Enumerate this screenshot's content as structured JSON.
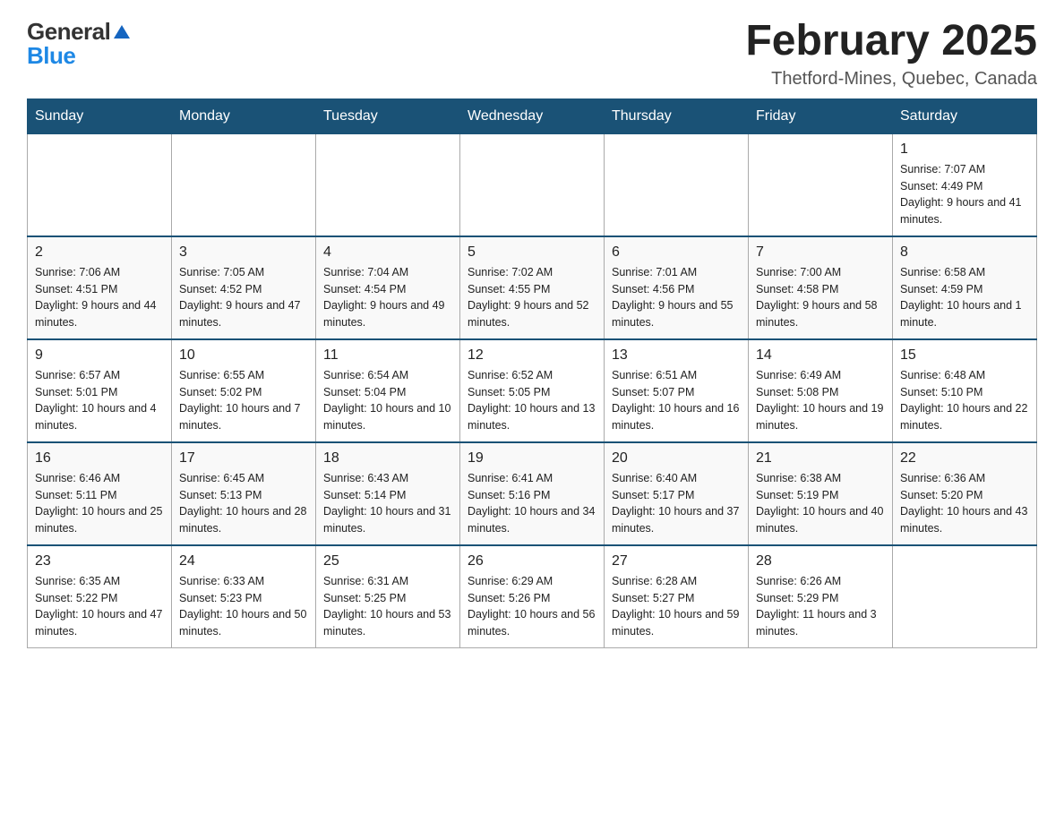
{
  "header": {
    "logo_general": "General",
    "logo_blue": "Blue",
    "month_title": "February 2025",
    "location": "Thetford-Mines, Quebec, Canada"
  },
  "weekdays": [
    "Sunday",
    "Monday",
    "Tuesday",
    "Wednesday",
    "Thursday",
    "Friday",
    "Saturday"
  ],
  "rows": [
    {
      "cells": [
        {
          "day": "",
          "info": ""
        },
        {
          "day": "",
          "info": ""
        },
        {
          "day": "",
          "info": ""
        },
        {
          "day": "",
          "info": ""
        },
        {
          "day": "",
          "info": ""
        },
        {
          "day": "",
          "info": ""
        },
        {
          "day": "1",
          "info": "Sunrise: 7:07 AM\nSunset: 4:49 PM\nDaylight: 9 hours and 41 minutes."
        }
      ]
    },
    {
      "cells": [
        {
          "day": "2",
          "info": "Sunrise: 7:06 AM\nSunset: 4:51 PM\nDaylight: 9 hours and 44 minutes."
        },
        {
          "day": "3",
          "info": "Sunrise: 7:05 AM\nSunset: 4:52 PM\nDaylight: 9 hours and 47 minutes."
        },
        {
          "day": "4",
          "info": "Sunrise: 7:04 AM\nSunset: 4:54 PM\nDaylight: 9 hours and 49 minutes."
        },
        {
          "day": "5",
          "info": "Sunrise: 7:02 AM\nSunset: 4:55 PM\nDaylight: 9 hours and 52 minutes."
        },
        {
          "day": "6",
          "info": "Sunrise: 7:01 AM\nSunset: 4:56 PM\nDaylight: 9 hours and 55 minutes."
        },
        {
          "day": "7",
          "info": "Sunrise: 7:00 AM\nSunset: 4:58 PM\nDaylight: 9 hours and 58 minutes."
        },
        {
          "day": "8",
          "info": "Sunrise: 6:58 AM\nSunset: 4:59 PM\nDaylight: 10 hours and 1 minute."
        }
      ]
    },
    {
      "cells": [
        {
          "day": "9",
          "info": "Sunrise: 6:57 AM\nSunset: 5:01 PM\nDaylight: 10 hours and 4 minutes."
        },
        {
          "day": "10",
          "info": "Sunrise: 6:55 AM\nSunset: 5:02 PM\nDaylight: 10 hours and 7 minutes."
        },
        {
          "day": "11",
          "info": "Sunrise: 6:54 AM\nSunset: 5:04 PM\nDaylight: 10 hours and 10 minutes."
        },
        {
          "day": "12",
          "info": "Sunrise: 6:52 AM\nSunset: 5:05 PM\nDaylight: 10 hours and 13 minutes."
        },
        {
          "day": "13",
          "info": "Sunrise: 6:51 AM\nSunset: 5:07 PM\nDaylight: 10 hours and 16 minutes."
        },
        {
          "day": "14",
          "info": "Sunrise: 6:49 AM\nSunset: 5:08 PM\nDaylight: 10 hours and 19 minutes."
        },
        {
          "day": "15",
          "info": "Sunrise: 6:48 AM\nSunset: 5:10 PM\nDaylight: 10 hours and 22 minutes."
        }
      ]
    },
    {
      "cells": [
        {
          "day": "16",
          "info": "Sunrise: 6:46 AM\nSunset: 5:11 PM\nDaylight: 10 hours and 25 minutes."
        },
        {
          "day": "17",
          "info": "Sunrise: 6:45 AM\nSunset: 5:13 PM\nDaylight: 10 hours and 28 minutes."
        },
        {
          "day": "18",
          "info": "Sunrise: 6:43 AM\nSunset: 5:14 PM\nDaylight: 10 hours and 31 minutes."
        },
        {
          "day": "19",
          "info": "Sunrise: 6:41 AM\nSunset: 5:16 PM\nDaylight: 10 hours and 34 minutes."
        },
        {
          "day": "20",
          "info": "Sunrise: 6:40 AM\nSunset: 5:17 PM\nDaylight: 10 hours and 37 minutes."
        },
        {
          "day": "21",
          "info": "Sunrise: 6:38 AM\nSunset: 5:19 PM\nDaylight: 10 hours and 40 minutes."
        },
        {
          "day": "22",
          "info": "Sunrise: 6:36 AM\nSunset: 5:20 PM\nDaylight: 10 hours and 43 minutes."
        }
      ]
    },
    {
      "cells": [
        {
          "day": "23",
          "info": "Sunrise: 6:35 AM\nSunset: 5:22 PM\nDaylight: 10 hours and 47 minutes."
        },
        {
          "day": "24",
          "info": "Sunrise: 6:33 AM\nSunset: 5:23 PM\nDaylight: 10 hours and 50 minutes."
        },
        {
          "day": "25",
          "info": "Sunrise: 6:31 AM\nSunset: 5:25 PM\nDaylight: 10 hours and 53 minutes."
        },
        {
          "day": "26",
          "info": "Sunrise: 6:29 AM\nSunset: 5:26 PM\nDaylight: 10 hours and 56 minutes."
        },
        {
          "day": "27",
          "info": "Sunrise: 6:28 AM\nSunset: 5:27 PM\nDaylight: 10 hours and 59 minutes."
        },
        {
          "day": "28",
          "info": "Sunrise: 6:26 AM\nSunset: 5:29 PM\nDaylight: 11 hours and 3 minutes."
        },
        {
          "day": "",
          "info": ""
        }
      ]
    }
  ]
}
